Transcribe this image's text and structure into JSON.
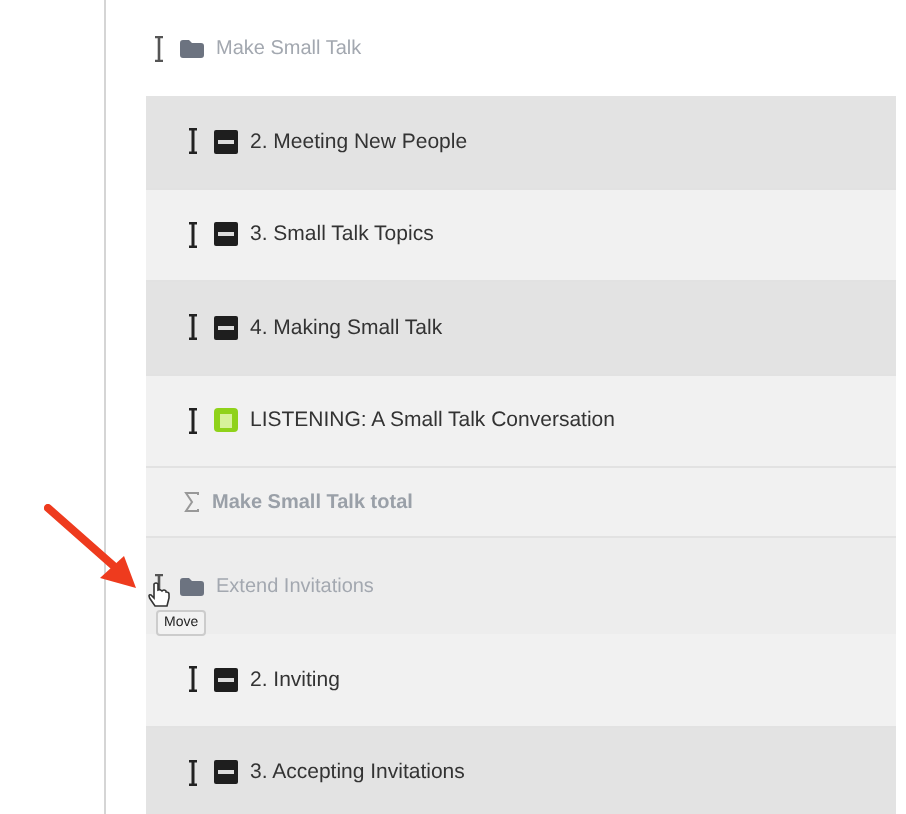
{
  "rows": [
    {
      "kind": "category",
      "title": "Make Small Talk",
      "shaded": false
    },
    {
      "kind": "page",
      "title": "2. Meeting New People",
      "shaded": true
    },
    {
      "kind": "page",
      "title": "3. Small Talk Topics",
      "shaded": false
    },
    {
      "kind": "page",
      "title": "4. Making Small Talk",
      "shaded": true
    },
    {
      "kind": "assignment",
      "title": "LISTENING: A Small Talk Conversation",
      "shaded": false
    },
    {
      "kind": "total",
      "title": "Make Small Talk total",
      "shaded": false
    },
    {
      "kind": "category",
      "title": "Extend Invitations",
      "shaded": true
    },
    {
      "kind": "page",
      "title": "2. Inviting",
      "shaded": false
    },
    {
      "kind": "page",
      "title": "3. Accepting Invitations",
      "shaded": true
    }
  ],
  "tooltip": "Move"
}
